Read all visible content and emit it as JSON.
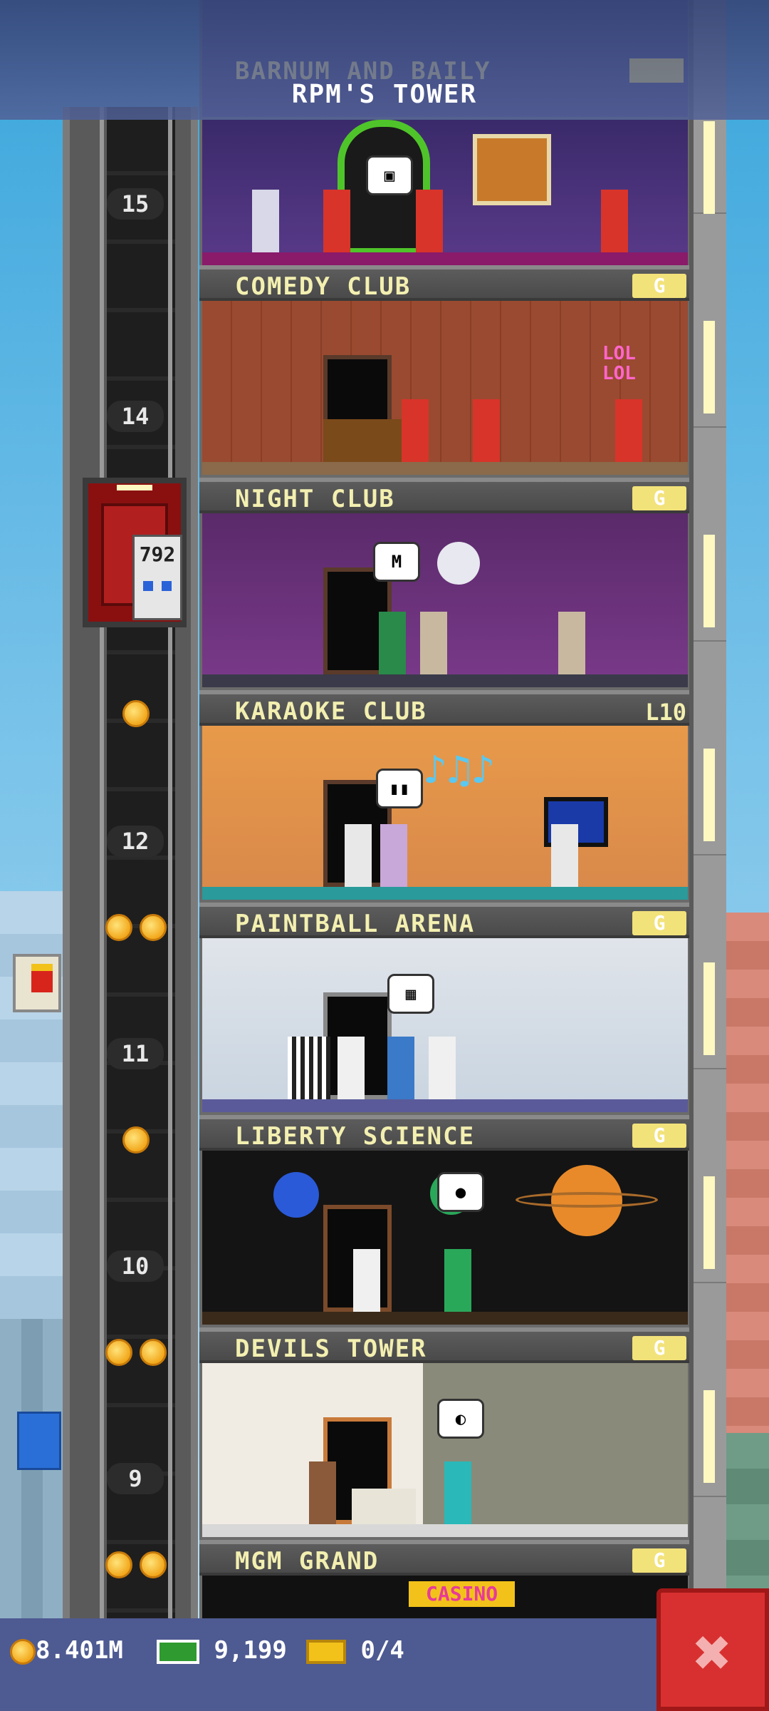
{
  "header": {
    "ghost_floor": "BARNUM AND BAILY",
    "title": "RPM'S TOWER"
  },
  "shaft": {
    "floor_numbers": [
      "15",
      "14",
      "12",
      "11",
      "10",
      "9"
    ],
    "elevator_display": "792"
  },
  "floors": [
    {
      "name": "COMEDY CLUB",
      "level": "G",
      "bubble": ""
    },
    {
      "name": "NIGHT CLUB",
      "level": "G",
      "bubble": "M"
    },
    {
      "name": "KARAOKE CLUB",
      "level": "L10",
      "bubble": ""
    },
    {
      "name": "PAINTBALL ARENA",
      "level": "G",
      "bubble": ""
    },
    {
      "name": "LIBERTY SCIENCE",
      "level": "G",
      "bubble": ""
    },
    {
      "name": "DEVILS TOWER",
      "level": "G",
      "bubble": ""
    },
    {
      "name": "MGM GRAND",
      "level": "G",
      "bubble": ""
    }
  ],
  "signs": {
    "lol": "LOL",
    "casino": "CASINO"
  },
  "resources": {
    "coins": "8.401M",
    "bux": "9,199",
    "tickets": "0/4"
  },
  "colors": {
    "label_text": "#f3efb0",
    "badge": "#f2e27a",
    "close": "#d83030",
    "bottom_bar": "#4e5a92"
  },
  "icons": [
    "coin-icon",
    "cash-icon",
    "golden-ticket-icon",
    "close-icon"
  ]
}
